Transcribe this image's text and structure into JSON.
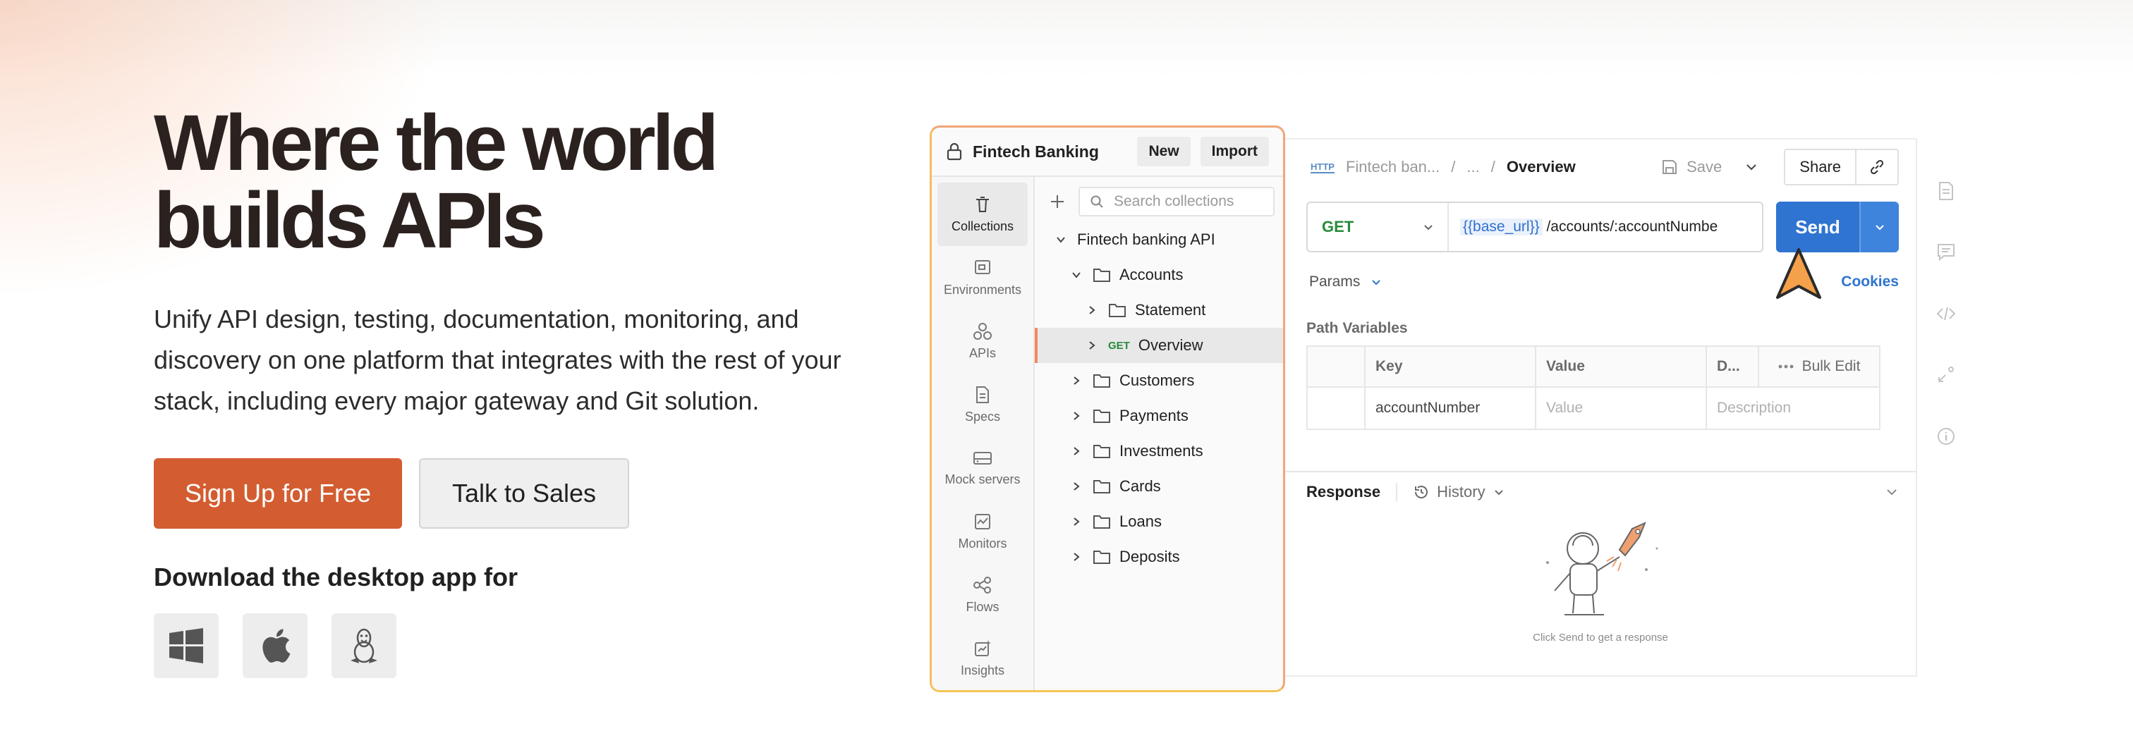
{
  "hero": {
    "headline": "Where the world builds APIs",
    "subtext": "Unify API design, testing, documentation, monitoring, and discovery on one platform that integrates with the rest of your stack, including every major gateway and Git solution.",
    "primary_cta": "Sign Up for Free",
    "secondary_cta": "Talk to Sales",
    "download_title": "Download the desktop app for",
    "os_options": [
      "windows-icon",
      "apple-icon",
      "linux-icon"
    ]
  },
  "app": {
    "workspace": {
      "title": "Fintech Banking",
      "new_label": "New",
      "import_label": "Import"
    },
    "nav": [
      {
        "label": "Collections",
        "icon": "trash-can-icon"
      },
      {
        "label": "Environments",
        "icon": "environment-icon"
      },
      {
        "label": "APIs",
        "icon": "apis-icon"
      },
      {
        "label": "Specs",
        "icon": "document-icon"
      },
      {
        "label": "Mock servers",
        "icon": "server-icon"
      },
      {
        "label": "Monitors",
        "icon": "monitor-icon"
      },
      {
        "label": "Flows",
        "icon": "flows-icon"
      },
      {
        "label": "Insights",
        "icon": "insights-icon"
      }
    ],
    "search_placeholder": "Search collections",
    "tree": {
      "root": "Fintech banking API",
      "accounts": "Accounts",
      "statement": "Statement",
      "overview_method": "GET",
      "overview": "Overview",
      "folders": [
        "Customers",
        "Payments",
        "Investments",
        "Cards",
        "Loans",
        "Deposits"
      ]
    },
    "tab": {
      "http_badge": "HTTP",
      "crumb_collection": "Fintech ban...",
      "crumb_sep1": "/",
      "crumb_ellipsis": "...",
      "crumb_sep2": "/",
      "crumb_current": "Overview",
      "save_label": "Save",
      "share_label": "Share"
    },
    "request": {
      "method": "GET",
      "url_variable": "{{base_url}}",
      "url_path": " /accounts/:accountNumbe",
      "send_label": "Send"
    },
    "params_label": "Params",
    "cookies_label": "Cookies",
    "path_variables_title": "Path Variables",
    "table": {
      "headers": [
        "Key",
        "Value",
        "D..."
      ],
      "bulk_edit": "Bulk Edit",
      "row": {
        "key": "accountNumber",
        "value_placeholder": "Value",
        "description_placeholder": "Description"
      }
    },
    "response": {
      "title": "Response",
      "history_label": "History",
      "empty_text": "Click Send to get a response"
    },
    "colors": {
      "accent_orange": "#d35d31",
      "send_blue": "#2f74d0",
      "get_green": "#268b3a"
    }
  }
}
